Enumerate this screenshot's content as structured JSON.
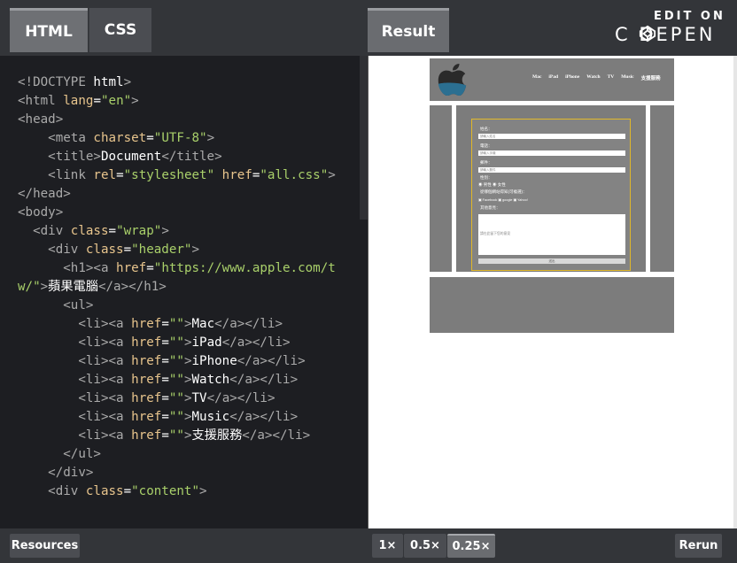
{
  "editor_tabs": {
    "html": "HTML",
    "css": "CSS",
    "result": "Result"
  },
  "branding": {
    "edit_on": "EDIT ON",
    "codepen": "C DEPEN"
  },
  "code_lines": [
    "<!DOCTYPE html>",
    "<html lang=\"en\">",
    "<head>",
    "    <meta charset=\"UTF-8\">",
    "    <title>Document</title>",
    "    <link rel=\"stylesheet\" href=\"all.css\">",
    "</head>",
    "<body>",
    "  <div class=\"wrap\">",
    "    <div class=\"header\">",
    "      <h1><a href=\"https://www.apple.com/tw/\">蘋果電腦</a></h1>",
    "      <ul>",
    "        <li><a href=\"\">Mac</a></li>",
    "        <li><a href=\"\">iPad</a></li>",
    "        <li><a href=\"\">iPhone</a></li>",
    "        <li><a href=\"\">Watch</a></li>",
    "        <li><a href=\"\">TV</a></li>",
    "        <li><a href=\"\">Music</a></li>",
    "        <li><a href=\"\">支援服務</a></li>",
    "      </ul>",
    "    </div>",
    "    <div class=\"content\">"
  ],
  "preview": {
    "nav": [
      "Mac",
      "iPad",
      "iPhone",
      "Watch",
      "TV",
      "Music",
      "支援服務"
    ],
    "form": {
      "name_label": "姓名：",
      "name_placeholder": "請輸入姓名",
      "phone_label": "電話：",
      "phone_placeholder": "請輸入手機",
      "email_label": "郵件：",
      "email_placeholder": "請輸入郵件",
      "gender_label": "性別：",
      "gender_options": "◉ 男性 ◉ 女性",
      "source_label": "從哪個網站得知(可複選)：",
      "source_options": "▣ Facebook ▣ google ▣ Yahoo!",
      "feedback_label": "其他意見：",
      "feedback_placeholder": "請在此留下您的意見",
      "submit": "送出"
    }
  },
  "bottom": {
    "resources": "Resources",
    "zoom_1x": "1×",
    "zoom_05x": "0.5×",
    "zoom_025x": "0.25×",
    "rerun": "Rerun"
  }
}
